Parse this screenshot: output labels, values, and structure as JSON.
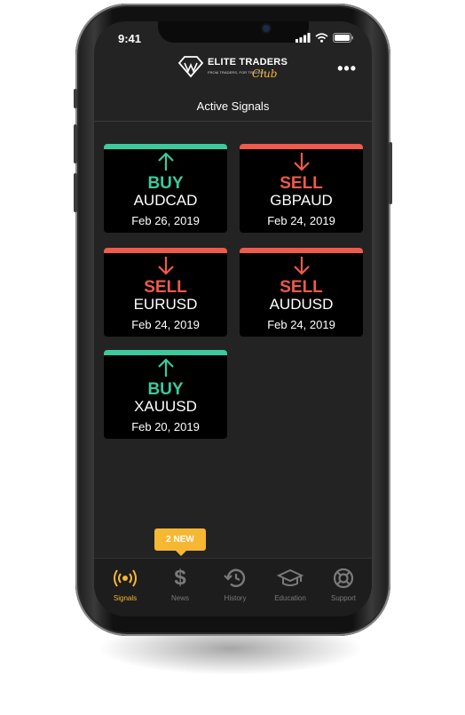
{
  "status": {
    "time": "9:41"
  },
  "brand": {
    "name": "ELITE TRADERS",
    "tagline": "FROM TRADERS, FOR TRADERS",
    "club": "Club"
  },
  "menu_label": "•••",
  "page_title": "Active Signals",
  "colors": {
    "buy": "#3cc99d",
    "sell": "#ef5a4a",
    "accent": "#f6b733",
    "badge_dot": "#f25a22"
  },
  "signals": [
    {
      "direction": "BUY",
      "pair": "AUDCAD",
      "date": "Feb 26, 2019"
    },
    {
      "direction": "SELL",
      "pair": "GBPAUD",
      "date": "Feb 24, 2019"
    },
    {
      "direction": "SELL",
      "pair": "EURUSD",
      "date": "Feb 24, 2019"
    },
    {
      "direction": "SELL",
      "pair": "AUDUSD",
      "date": "Feb 24, 2019"
    },
    {
      "direction": "BUY",
      "pair": "XAUUSD",
      "date": "Feb 20, 2019"
    }
  ],
  "news_badge": "2 NEW",
  "tabs": [
    {
      "label": "Signals",
      "icon": "broadcast-icon",
      "active": true
    },
    {
      "label": "News",
      "icon": "dollar-icon",
      "active": false
    },
    {
      "label": "History",
      "icon": "history-icon",
      "active": false
    },
    {
      "label": "Education",
      "icon": "graduation-cap-icon",
      "active": false
    },
    {
      "label": "Support",
      "icon": "lifebuoy-icon",
      "active": false
    }
  ]
}
